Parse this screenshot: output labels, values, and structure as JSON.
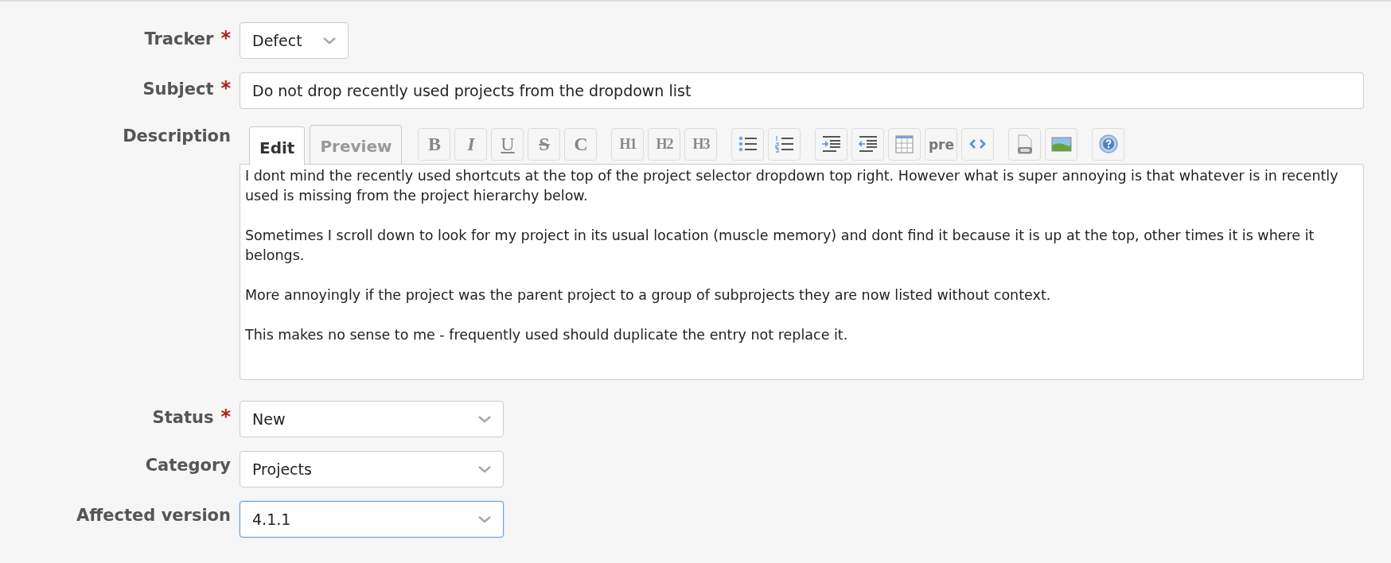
{
  "fields": [
    {
      "kind": "select",
      "label": "Tracker",
      "required_mark": "*",
      "value": "Defect",
      "focused": false
    },
    {
      "kind": "text",
      "label": "Subject",
      "required_mark": "*",
      "value": "Do not drop recently used projects from the dropdown list"
    },
    {
      "kind": "editor",
      "label": "Description",
      "tabs": [
        {
          "label": "Edit",
          "selected": true
        },
        {
          "label": "Preview",
          "selected": false
        }
      ],
      "toolbar": [
        [
          {
            "kind": "text",
            "label": "B"
          },
          {
            "kind": "text",
            "label": "I"
          },
          {
            "kind": "text",
            "label": "U"
          },
          {
            "kind": "text",
            "label": "S"
          },
          {
            "kind": "text",
            "label": "C"
          }
        ],
        [
          {
            "kind": "text",
            "label": "H1"
          },
          {
            "kind": "text",
            "label": "H2"
          },
          {
            "kind": "text",
            "label": "H3"
          }
        ],
        [
          {
            "kind": "icon"
          },
          {
            "kind": "icon"
          }
        ],
        [
          {
            "kind": "icon"
          },
          {
            "kind": "icon"
          },
          {
            "kind": "icon"
          },
          {
            "kind": "text",
            "label": "pre"
          },
          {
            "kind": "icon"
          }
        ],
        [
          {
            "kind": "icon"
          },
          {
            "kind": "icon"
          }
        ],
        [
          {
            "kind": "icon"
          }
        ]
      ],
      "value": "I dont mind the recently used shortcuts at the top of the project selector dropdown top right. However what is super annoying is that whatever is in recently used is missing from the project hierarchy below.\n\nSometimes I scroll down to look for my project in its usual location (muscle memory) and dont find it because it is up at the top, other times it is where it belongs.\n\nMore annoyingly if the project was the parent project to a group of subprojects they are now listed without context.\n\nThis makes no sense to me - frequently used should duplicate the entry not replace it."
    },
    {
      "kind": "select",
      "label": "Status",
      "required_mark": "*",
      "value": "New",
      "focused": false
    },
    {
      "kind": "select",
      "label": "Category",
      "value": "Projects",
      "focused": false
    },
    {
      "kind": "select",
      "label": "Affected version",
      "value": "4.1.1",
      "focused": true
    }
  ]
}
